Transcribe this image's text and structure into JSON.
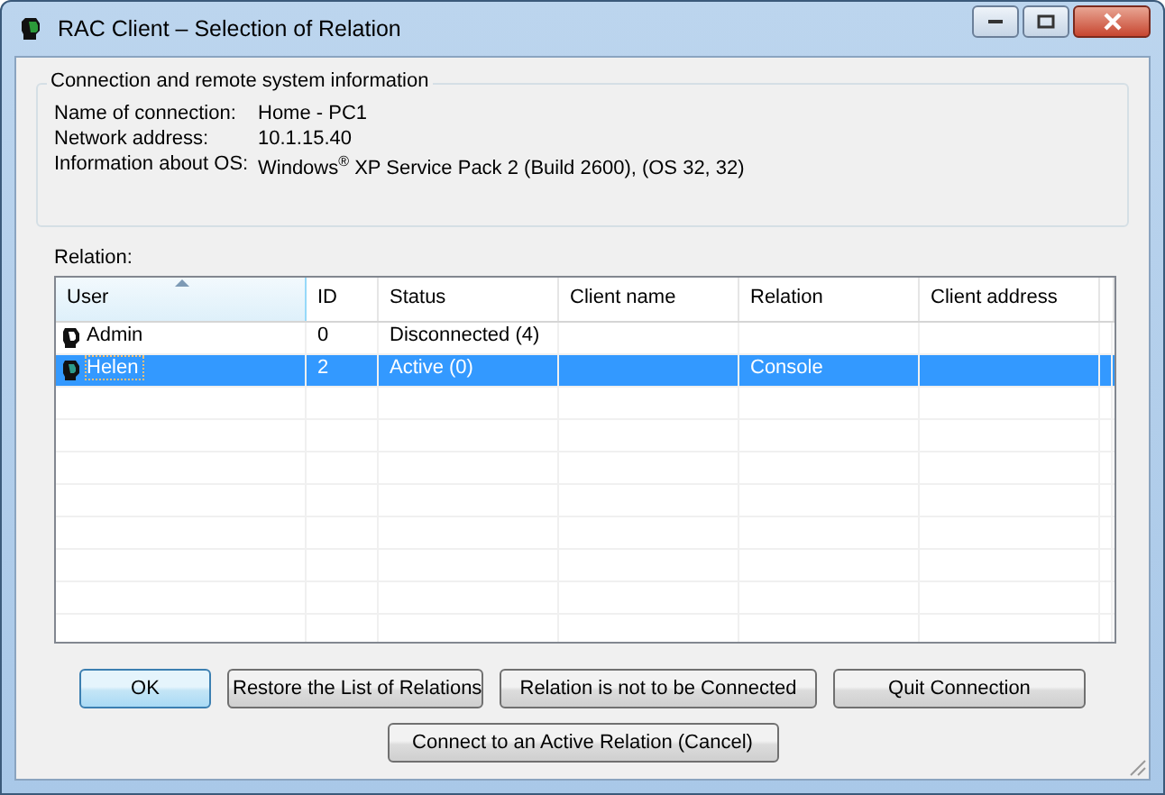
{
  "window": {
    "title": "RAC Client – Selection of Relation"
  },
  "info_group": {
    "title": "Connection and remote system information",
    "fields": [
      {
        "label": "Name of connection:",
        "value": "Home - PC1"
      },
      {
        "label": "Network address:",
        "value": "10.1.15.40"
      },
      {
        "label": "Information about OS:",
        "value": "Windows$^{®}$ XP Service Pack 2 (Build 2600), (OS 32, 32)"
      }
    ]
  },
  "relation_label": "Relation:",
  "table": {
    "columns": [
      {
        "label": "User",
        "sorted": true
      },
      {
        "label": "ID",
        "sorted": false
      },
      {
        "label": "Status",
        "sorted": false
      },
      {
        "label": "Client name",
        "sorted": false
      },
      {
        "label": "Relation",
        "sorted": false
      },
      {
        "label": "Client address",
        "sorted": false
      }
    ],
    "rows": [
      {
        "selected": false,
        "cells": [
          "Admin",
          "0",
          "Disconnected (4)",
          "",
          "",
          ""
        ]
      },
      {
        "selected": true,
        "cells": [
          "Helen",
          "2",
          "Active (0)",
          "",
          "Console",
          ""
        ]
      }
    ]
  },
  "buttons": [
    {
      "label": "OK",
      "default": true
    },
    {
      "label": "Restore the List of Relations",
      "default": false
    },
    {
      "label": "Relation is not to be Connected",
      "default": false
    },
    {
      "label": "Quit Connection",
      "default": false
    }
  ],
  "bottom_button": {
    "label": "Connect to an Active Relation (Cancel)"
  }
}
